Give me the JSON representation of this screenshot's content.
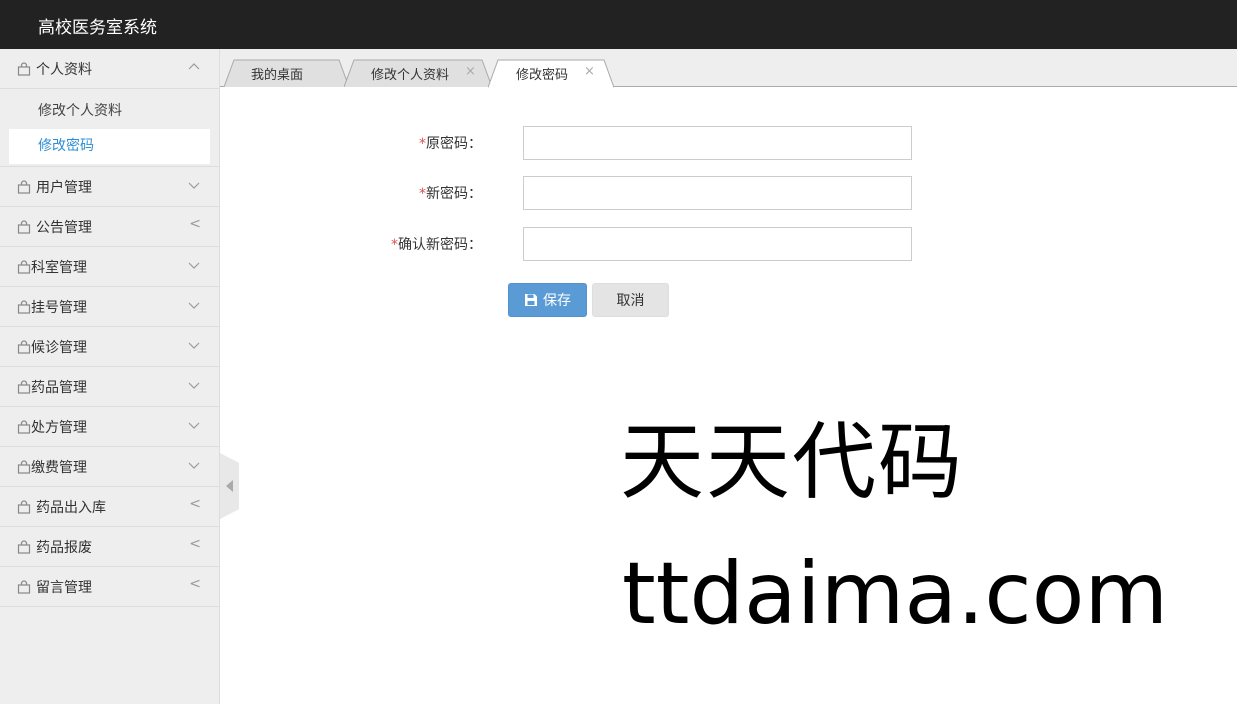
{
  "app": {
    "title": "高校医务室系统"
  },
  "sidebar": {
    "groups": [
      {
        "label": "个人资料",
        "indicator": "chevron-up"
      },
      {
        "label": "用户管理",
        "indicator": "chevron-down"
      },
      {
        "label": "公告管理",
        "indicator": "<"
      },
      {
        "label": "科室管理",
        "indicator": "chevron-down"
      },
      {
        "label": "挂号管理",
        "indicator": "chevron-down"
      },
      {
        "label": "候诊管理",
        "indicator": "chevron-down"
      },
      {
        "label": "药品管理",
        "indicator": "chevron-down"
      },
      {
        "label": "处方管理",
        "indicator": "chevron-down"
      },
      {
        "label": "缴费管理",
        "indicator": "chevron-down"
      },
      {
        "label": "药品出入库",
        "indicator": "<"
      },
      {
        "label": "药品报废",
        "indicator": "<"
      },
      {
        "label": "留言管理",
        "indicator": "<"
      }
    ],
    "sub_items": [
      {
        "label": "修改个人资料"
      },
      {
        "label": "修改密码",
        "active": true
      }
    ],
    "collapse_glyph": "<"
  },
  "tabs": [
    {
      "label": "我的桌面",
      "closable": false
    },
    {
      "label": "修改个人资料",
      "closable": true,
      "close": "×"
    },
    {
      "label": "修改密码",
      "closable": true,
      "close": "×",
      "active": true
    }
  ],
  "form": {
    "required_mark": "*",
    "fields": [
      {
        "label": "原密码：",
        "value": ""
      },
      {
        "label": "新密码：",
        "value": ""
      },
      {
        "label": "确认新密码：",
        "value": ""
      }
    ],
    "save_label": "保存",
    "cancel_label": "取消"
  },
  "watermark": {
    "line1": "天天代码",
    "line2": "ttdaima.com"
  },
  "colors": {
    "topbar": "#222222",
    "accent": "#2e8ed5",
    "save_button": "#5b9bd5",
    "required": "#d9534f"
  }
}
